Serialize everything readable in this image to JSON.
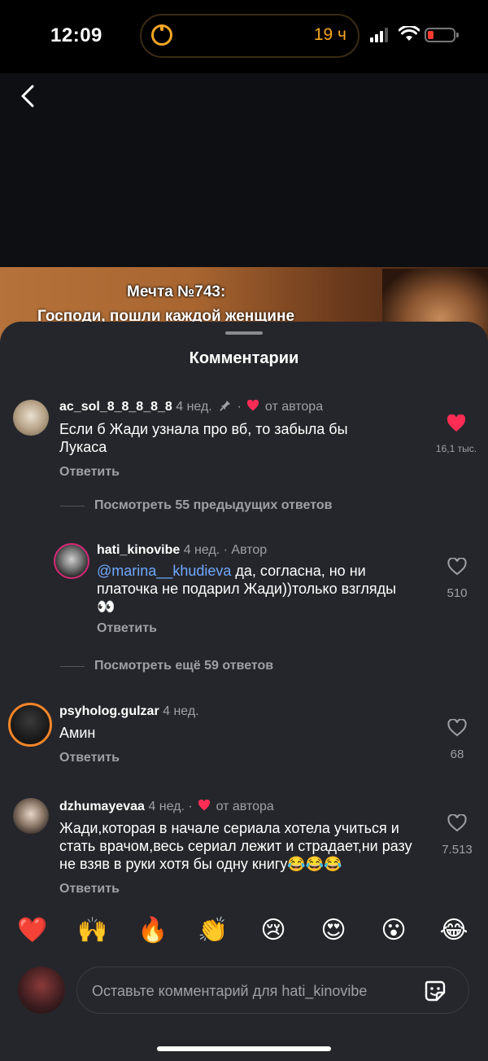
{
  "status": {
    "time": "12:09",
    "timer": "19 ч"
  },
  "video": {
    "caption_line1": "Мечта №743:",
    "caption_line2": "Господи, пошли каждой женщине"
  },
  "sheet": {
    "title": "Комментарии"
  },
  "comments": [
    {
      "username": "ac_sol_8_8_8_8_8",
      "meta": " 4 нед.",
      "author_liked": "от автора",
      "text": "Если б Жади узнала про вб, то забыла бы Лукаса",
      "reply": "Ответить",
      "likes": "16,1 тыс.",
      "liked": true
    },
    {
      "username": "hati_kinovibe",
      "meta": " 4 нед. · Автор",
      "mention": "@marina__khudieva",
      "text": " да, согласна, но ни платочка не подарил Жади))только взгляды👀",
      "reply": "Ответить",
      "likes": "510"
    },
    {
      "username": "psyholog.gulzar",
      "meta": " 4 нед.",
      "text": "Амин",
      "reply": "Ответить",
      "likes": "68"
    },
    {
      "username": "dzhumayevaa",
      "meta": " 4 нед. ·",
      "author_liked": "от автора",
      "text": "Жади,которая в начале сериала хотела учиться и стать врачом,весь сериал лежит и страдает,ни разу не взяв в руки хотя бы одну книгу😂😂😂",
      "reply": "Ответить",
      "likes": "7.513"
    }
  ],
  "threads": {
    "view_previous": "Посмотреть 55 предыдущих ответов",
    "view_more": "Посмотреть ещё 59 ответов"
  },
  "emoji_bar": [
    "❤️",
    "🙌",
    "🔥",
    "👏",
    "😢",
    "😍",
    "😮",
    "😂"
  ],
  "composer": {
    "placeholder": "Оставьте комментарий для hati_kinovibe"
  },
  "colors": {
    "sheet_bg": "#25262b",
    "like_red": "#ff2d55",
    "mention_blue": "#6fa8ff",
    "timer_orange": "#f5a623"
  }
}
